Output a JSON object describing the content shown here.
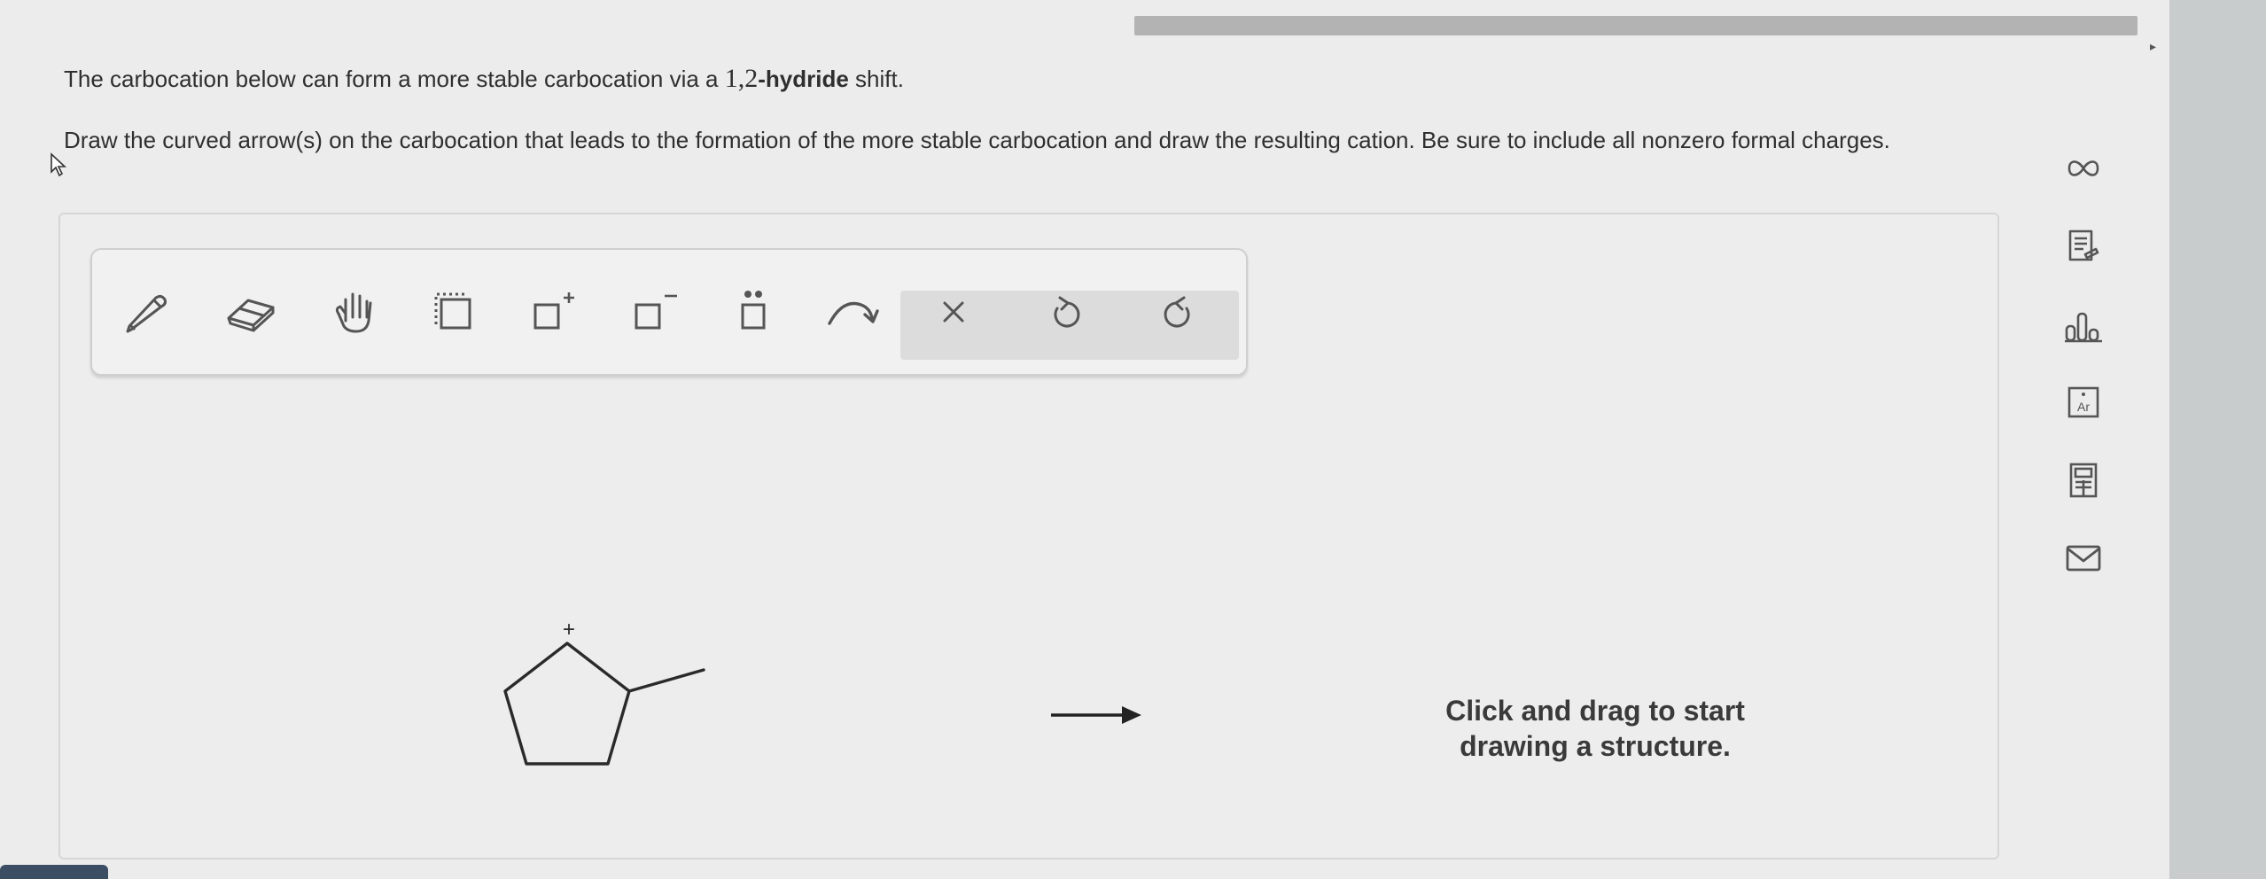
{
  "question": {
    "line1_start": "The carbocation below can form a more stable carbocation via a ",
    "line1_numbers": "1,2",
    "line1_bold": "-hydride",
    "line1_end": " shift.",
    "line2": "Draw the curved arrow(s) on the carbocation that leads to the formation of the more stable carbocation and draw the resulting cation. Be sure to include all nonzero formal charges."
  },
  "toolbar": {
    "tools": [
      "pencil-icon",
      "eraser-icon",
      "hand-icon",
      "select-icon",
      "add-positive-charge-icon",
      "add-negative-charge-icon",
      "lone-pair-icon",
      "curved-arrow-icon",
      "clear-icon",
      "undo-icon",
      "redo-icon"
    ]
  },
  "canvas": {
    "charge_label": "+",
    "hint_line1": "Click and drag to start",
    "hint_line2": "drawing a structure."
  },
  "side_tools": {
    "icons": [
      "infinity-icon",
      "document-icon",
      "chart-icon",
      "periodic-table-icon",
      "calculator-icon",
      "mail-icon"
    ],
    "periodic_label": "Ar"
  },
  "colors": {
    "background": "#ececec",
    "text": "#2f2f2f",
    "icon_gray": "#555555",
    "toolbar_active_bg": "#dcdcdc"
  }
}
